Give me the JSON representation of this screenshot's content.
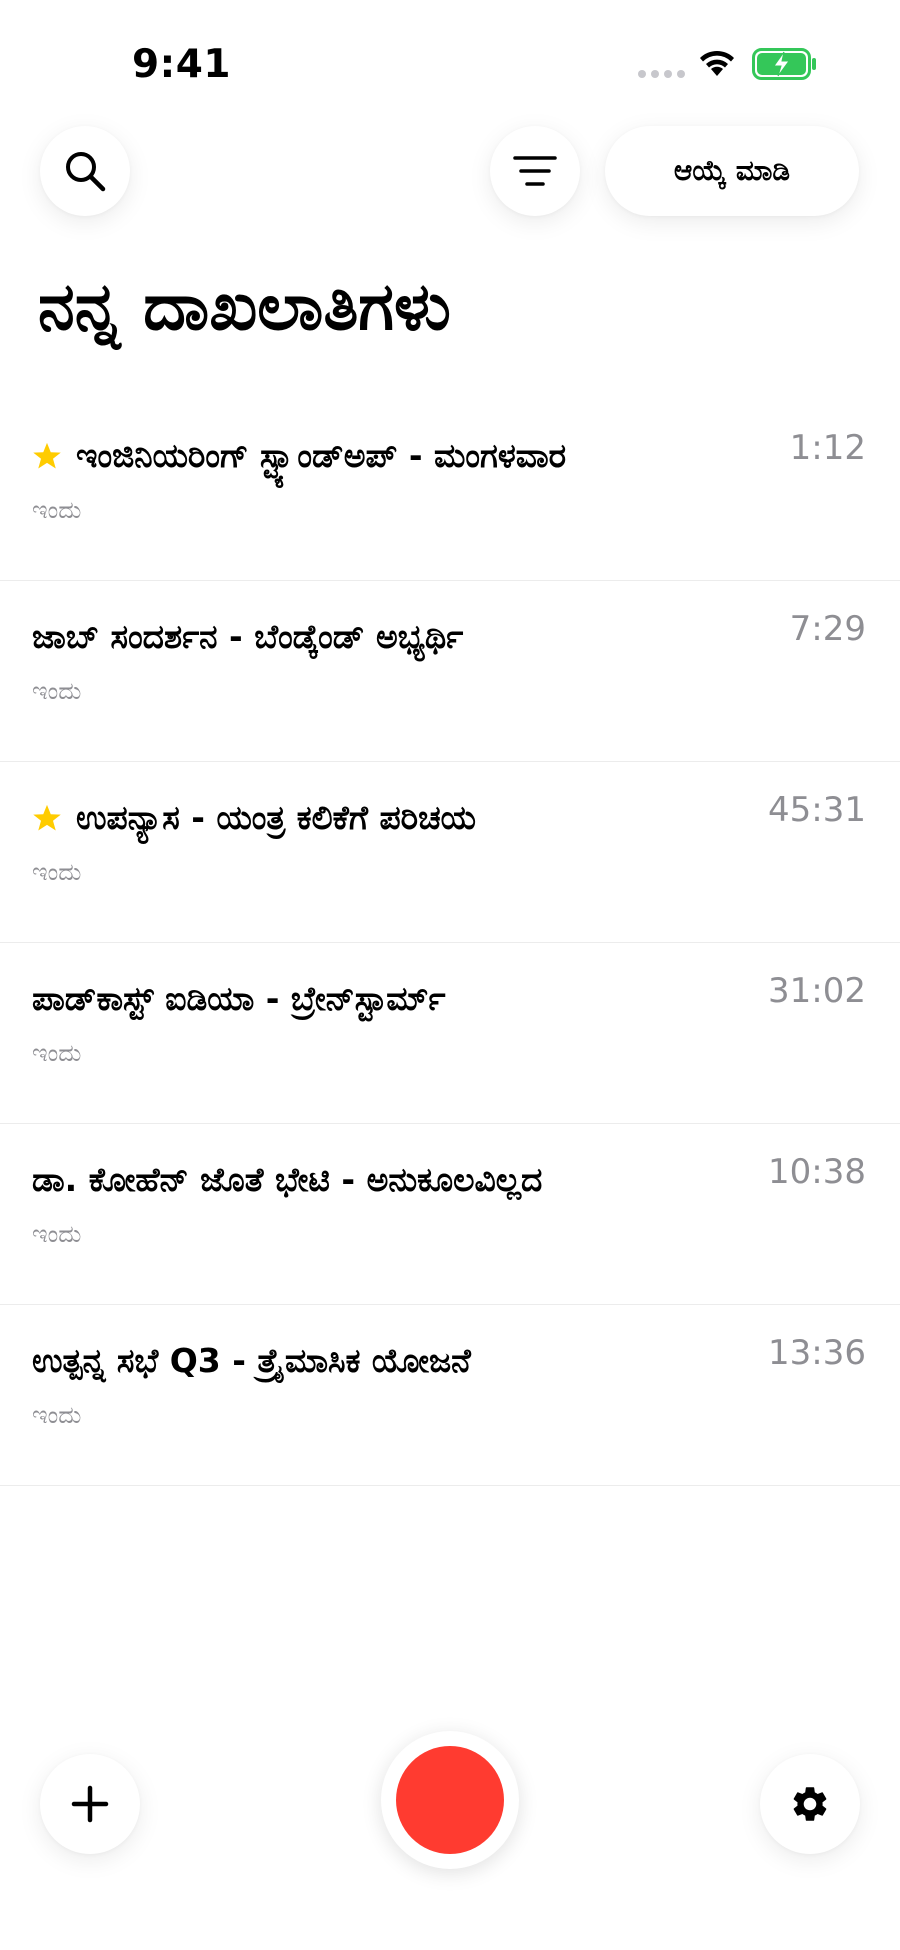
{
  "status_bar": {
    "time": "9:41"
  },
  "toolbar": {
    "search_icon": "search-icon",
    "filter_icon": "filter-icon",
    "select_label": "ಆಯ್ಕೆ ಮಾಡಿ"
  },
  "page_title": "ನನ್ನ ದಾಖಲಾತಿಗಳು",
  "recordings": [
    {
      "title": "ಇಂಜಿನಿಯರಿಂಗ್ ಸ್ಟ್ಯಾಂಡ್‌ಅಪ್ - ಮಂಗಳವಾರ",
      "date": "ಇಂದು",
      "duration": "1:12",
      "starred": true
    },
    {
      "title": "ಜಾಬ್ ಸಂದರ್ಶನ - ಬೆಂಡ್ಕೆಂಡ್ ಅಭ್ಯರ್ಥಿ",
      "date": "ಇಂದು",
      "duration": "7:29",
      "starred": false
    },
    {
      "title": "ಉಪನ್ಯಾಸ - ಯಂತ್ರ ಕಲಿಕೆಗೆ ಪರಿಚಯ",
      "date": "ಇಂದು",
      "duration": "45:31",
      "starred": true
    },
    {
      "title": "ಪಾಡ್‌ಕಾಸ್ಟ್ ಐಡಿಯಾ - ಬ್ರೇನ್‌ಸ್ಟಾರ್ಮ್",
      "date": "ಇಂದು",
      "duration": "31:02",
      "starred": false
    },
    {
      "title": "ಡಾ. ಕೋಹೆನ್ ಜೊತೆ ಭೇಟಿ - ಅನುಕೂಲವಿಲ್ಲದ",
      "date": "ಇಂದು",
      "duration": "10:38",
      "starred": false
    },
    {
      "title": "ಉತ್ಪನ್ನ ಸಭೆ Q3 - ತ್ರೈಮಾಸಿಕ ಯೋಜನೆ",
      "date": "ಇಂದು",
      "duration": "13:36",
      "starred": false
    }
  ],
  "bottom_bar": {
    "add_icon": "plus-icon",
    "record_icon": "record-icon",
    "settings_icon": "gear-icon"
  },
  "colors": {
    "star": "#FFCC00",
    "record": "#FF3B30",
    "secondary_text": "#8E8E93",
    "battery": "#34C759"
  }
}
